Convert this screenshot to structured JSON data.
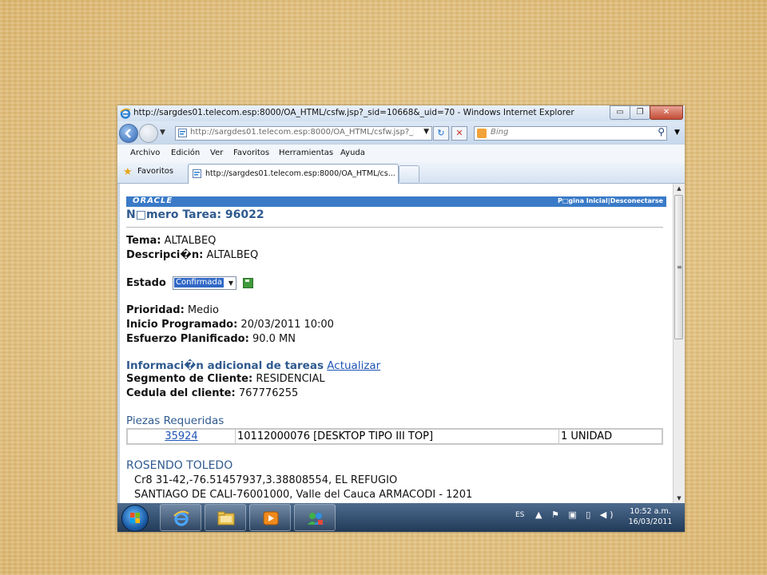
{
  "window": {
    "title": "http://sargdes01.telecom.esp:8000/OA_HTML/csfw.jsp?_sid=10668&_uid=70 - Windows Internet Explorer",
    "minimize_glyph": "▭",
    "restore_glyph": "❐",
    "close_glyph": "✕"
  },
  "nav": {
    "address_url": "http://sargdes01.telecom.esp:8000/OA_HTML/csfw.jsp?_sid=",
    "search_placeholder": "Bing",
    "refresh_glyph": "↻",
    "stop_glyph": "✕",
    "search_glyph": "⚲",
    "dropdown_glyph": "▼"
  },
  "menu": [
    "Archivo",
    "Edición",
    "Ver",
    "Favoritos",
    "Herramientas",
    "Ayuda"
  ],
  "favorites": {
    "label": "Favoritos",
    "tab_label": "http://sargdes01.telecom.esp:8000/OA_HTML/cs..."
  },
  "page": {
    "logo": "ORACLE",
    "top_links": "P□gina Inicial|Desconectarse",
    "task_heading": "N□mero Tarea: 96022",
    "tema_label": "Tema:",
    "tema_value": "ALTALBEQ",
    "descripcion_label": "Descripci�n:",
    "descripcion_value": "ALTALBEQ",
    "estado_label": "Estado",
    "estado_value": "Confirmada",
    "prioridad_label": "Prioridad:",
    "prioridad_value": "Medio",
    "inicio_label": "Inicio Programado:",
    "inicio_value": "20/03/2011 10:00",
    "esfuerzo_label": "Esfuerzo Planificado:",
    "esfuerzo_value": "90.0 MN",
    "info_heading": "Informaci�n adicional de tareas",
    "actualizar_link": "Actualizar",
    "segmento_label": "Segmento de Cliente:",
    "segmento_value": "RESIDENCIAL",
    "cedula_label": "Cedula del cliente:",
    "cedula_value": "767776255",
    "piezas_heading": "Piezas Requeridas",
    "piezas": [
      {
        "code": "35924",
        "description": "10112000076 [DESKTOP TIPO III TOP]",
        "quantity": "1 UNIDAD"
      }
    ],
    "customer_name": "ROSENDO TOLEDO",
    "address_line1": "Cr8 31-42,-76.51457937,3.38808554, EL REFUGIO",
    "address_line2": "SANTIAGO DE CALI-76001000, Valle del Cauca ARMACODI - 1201"
  },
  "taskbar": {
    "language": "ES",
    "tray_icons": "▲ ⚑ ▣ ▯ ◀)",
    "time": "10:52 a.m.",
    "date": "16/03/2011",
    "apps": [
      "internet-explorer",
      "windows-explorer",
      "media-player",
      "people-app"
    ]
  },
  "colors": {
    "oracle_bar": "#3a7ac7",
    "heading_blue": "#2f5a8f",
    "link_blue": "#1f55b5",
    "selection_blue": "#3168c6"
  }
}
